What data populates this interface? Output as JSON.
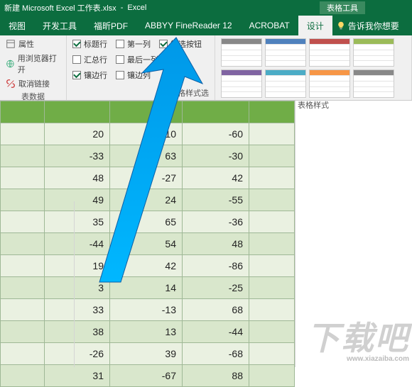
{
  "titlebar": {
    "filename": "新建 Microsoft Excel 工作表.xlsx",
    "app": "Excel",
    "context_tab": "表格工具"
  },
  "menu": {
    "tabs": [
      "视图",
      "开发工具",
      "福昕PDF",
      "ABBYY FineReader 12",
      "ACROBAT",
      "设计"
    ],
    "active": "设计",
    "tell_me": "告诉我你想要"
  },
  "ribbon": {
    "group1": {
      "items": [
        "属性",
        "用浏览器打开",
        "取消链接"
      ],
      "label": "表数据"
    },
    "group2": {
      "row1": [
        {
          "label": "标题行",
          "checked": true
        },
        {
          "label": "第一列",
          "checked": false
        },
        {
          "label": "筛选按钮",
          "checked": true
        }
      ],
      "row2": [
        {
          "label": "汇总行",
          "checked": false
        },
        {
          "label": "最后一列",
          "checked": false
        }
      ],
      "row3": [
        {
          "label": "镶边行",
          "checked": true
        },
        {
          "label": "镶边列",
          "checked": false
        }
      ],
      "label": "表格样式选"
    },
    "group3": {
      "label": "表格样式"
    }
  },
  "table": {
    "rows": [
      [
        20,
        10,
        -60
      ],
      [
        -33,
        63,
        -30
      ],
      [
        48,
        -27,
        42
      ],
      [
        49,
        24,
        -55
      ],
      [
        35,
        65,
        -36
      ],
      [
        -44,
        54,
        48
      ],
      [
        19,
        42,
        -86
      ],
      [
        3,
        14,
        -25
      ],
      [
        33,
        -13,
        68
      ],
      [
        38,
        13,
        -44
      ],
      [
        -26,
        39,
        -68
      ],
      [
        31,
        -67,
        88
      ]
    ]
  },
  "watermark": {
    "text": "下载吧",
    "url": "www.xiazaiba.com"
  },
  "style_colors": [
    "#888888",
    "#4f81bd",
    "#c0504d",
    "#9bbb59",
    "#8064a2",
    "#4bacc6",
    "#f79646",
    "#888888"
  ]
}
